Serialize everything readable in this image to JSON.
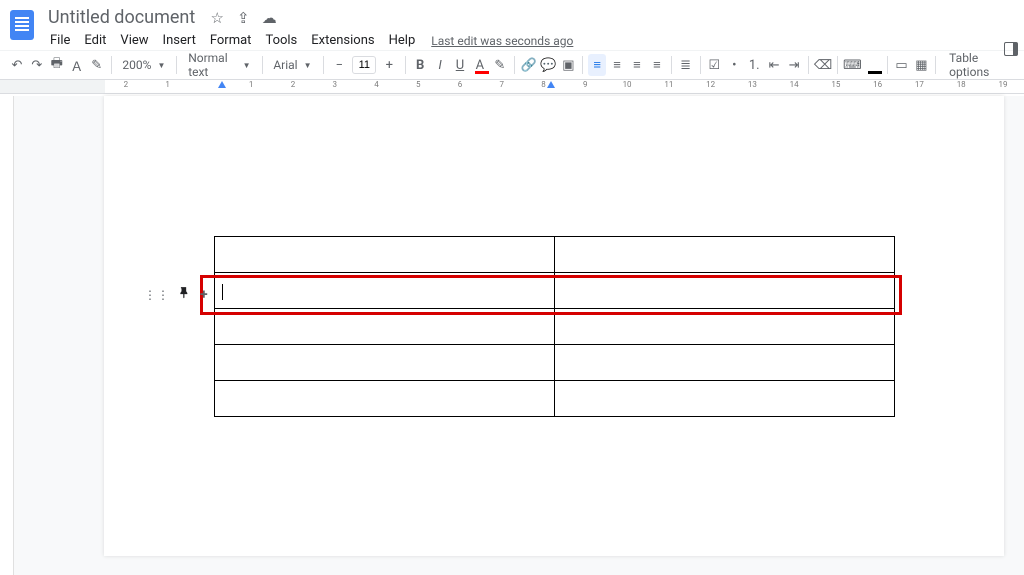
{
  "doc": {
    "title": "Untitled document"
  },
  "menu": {
    "file": "File",
    "edit": "Edit",
    "view": "View",
    "insert": "Insert",
    "format": "Format",
    "tools": "Tools",
    "extensions": "Extensions",
    "help": "Help",
    "last_edit": "Last edit was seconds ago"
  },
  "toolbar": {
    "zoom": "200%",
    "style": "Normal text",
    "font": "Arial",
    "font_size": "11",
    "table_options": "Table options"
  },
  "ruler": {
    "numbers": [
      "2",
      "1",
      "",
      "1",
      "2",
      "3",
      "4",
      "5",
      "6",
      "7",
      "8",
      "9",
      "10",
      "11",
      "12",
      "13",
      "14",
      "15",
      "16",
      "17",
      "18",
      "19"
    ]
  },
  "table": {
    "rows": 5,
    "cols": 2,
    "selected_row_index": 1,
    "cells": [
      [
        "",
        ""
      ],
      [
        "",
        ""
      ],
      [
        "",
        ""
      ],
      [
        "",
        ""
      ],
      [
        "",
        ""
      ]
    ]
  },
  "icons": {
    "star": "☆",
    "move": "⇪",
    "cloud": "☁",
    "undo": "↶",
    "redo": "↷",
    "print": "🖶",
    "spell": "Ａ",
    "paint": "✎",
    "bold": "B",
    "italic": "I",
    "underline": "U",
    "textcolor": "A",
    "highlight": "✎",
    "link": "🔗",
    "comment": "💬",
    "image": "▣",
    "alignL": "≡",
    "alignC": "≡",
    "alignR": "≡",
    "alignJ": "≡",
    "linesp": "≣",
    "checklist": "☑",
    "bullets": "•",
    "numbers_list": "1.",
    "dec_indent": "⇤",
    "inc_indent": "⇥",
    "clear": "⌫",
    "input": "⌨",
    "borderw": "▭",
    "cellbg": "▦",
    "minus": "−",
    "plus": "+",
    "pin": "📌",
    "grip": "⋮⋮"
  }
}
